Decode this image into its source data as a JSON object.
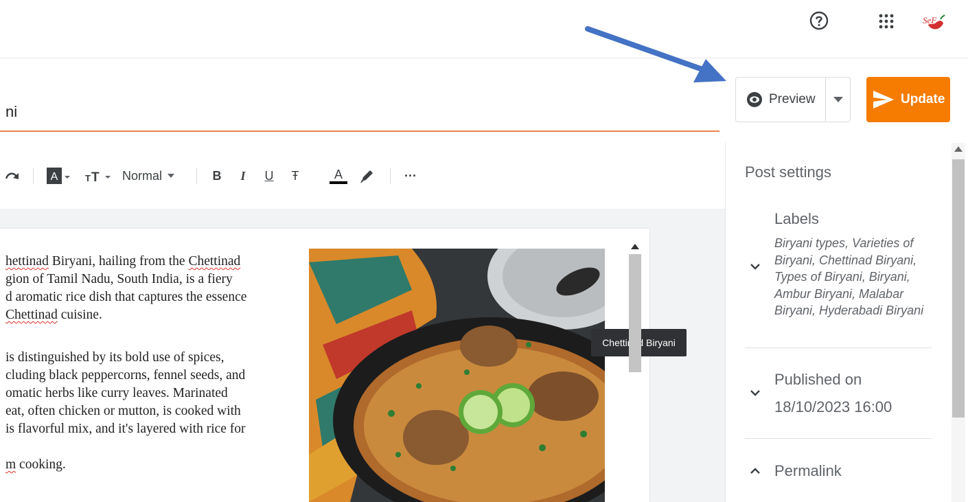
{
  "header": {
    "help_icon": "help-circle-icon",
    "apps_icon": "apps-grid-icon",
    "avatar_text": "SeF"
  },
  "post": {
    "title_fragment": "ni"
  },
  "actions": {
    "preview_label": "Preview",
    "update_label": "Update",
    "accent_color": "#f57c00"
  },
  "toolbar": {
    "text_style": "Normal",
    "bold": "B",
    "italic": "I",
    "underline": "U",
    "strike": "Ŧ",
    "text_color": "A",
    "more": "···"
  },
  "editor": {
    "paragraph1": [
      {
        "pre": "",
        "sq": "hettinad",
        "post": " Biryani, hailing from the "
      },
      {
        "pre": "",
        "sq": "Chettinad",
        "post": ""
      }
    ],
    "p1_line1_a": "hettinad",
    "p1_line1_b": " Biryani, hailing from the ",
    "p1_line1_c": "Chettinad",
    "p1_line2": "gion of Tamil Nadu, South India, is a fiery",
    "p1_line3": "d aromatic rice dish that captures the essence",
    "p1_line4_a": "Chettinad",
    "p1_line4_b": " cuisine.",
    "p2_line1": "is distinguished by its bold use of spices,",
    "p2_line2": "cluding black peppercorns, fennel seeds, and",
    "p2_line3": "omatic herbs like curry leaves. Marinated",
    "p2_line4": "eat, often chicken or mutton, is cooked with",
    "p2_line5": "is flavorful mix, and it's layered with rice for",
    "p2_line6_a": "m",
    "p2_line6_b": " cooking.",
    "image_tooltip": "Chettinad Biryani"
  },
  "post_settings": {
    "title": "Post settings",
    "labels_title": "Labels",
    "labels_values": "Biryani types, Varieties of Biryani, Chettinad Biryani, Types of Biryani, Biryani, Ambur Biryani, Malabar Biryani, Hyderabadi Biryani",
    "published_title": "Published on",
    "published_date": "18/10/2023 16:00",
    "permalink_title": "Permalink"
  }
}
